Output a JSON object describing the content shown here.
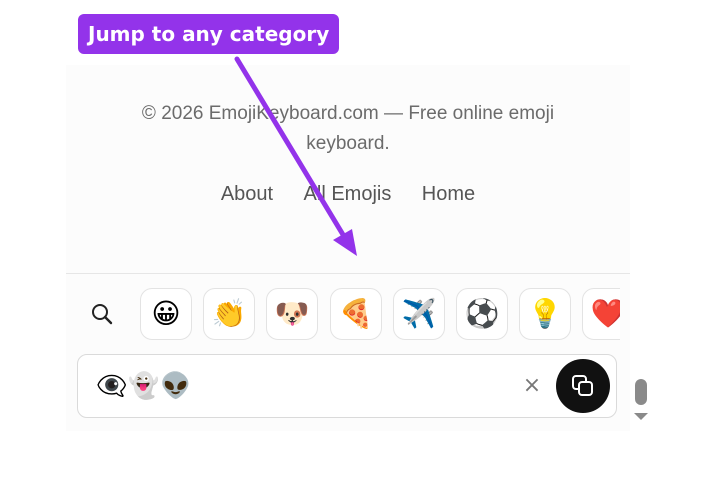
{
  "callout": {
    "text": "Jump to any category",
    "color": "#9333ea"
  },
  "footer": {
    "copyright": "© 2026 EmojiKeyboard.com — Free online emoji keyboard.",
    "links": [
      "About",
      "All Emojis",
      "Home"
    ]
  },
  "keyboard": {
    "categories": [
      {
        "name": "search",
        "icon": "search-icon"
      },
      {
        "name": "smileys",
        "glyph": "😀"
      },
      {
        "name": "people",
        "glyph": "👏"
      },
      {
        "name": "animals",
        "glyph": "🐶"
      },
      {
        "name": "food",
        "glyph": "🍕"
      },
      {
        "name": "travel",
        "glyph": "✈️"
      },
      {
        "name": "activities",
        "glyph": "⚽"
      },
      {
        "name": "objects",
        "glyph": "💡"
      },
      {
        "name": "symbols",
        "glyph": "❤️"
      }
    ],
    "output": {
      "text": "👁️‍🗨️👻👽"
    },
    "clear_label": "×",
    "copy_icon": "copy-icon"
  }
}
